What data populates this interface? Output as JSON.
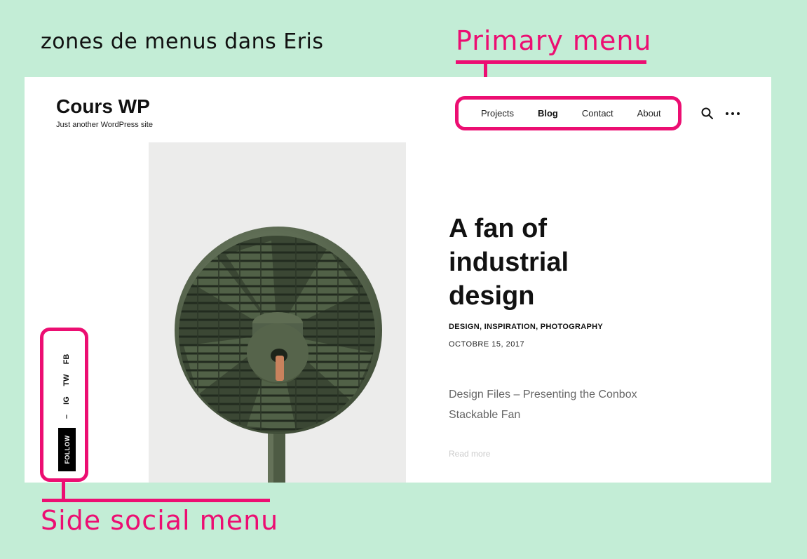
{
  "annotation": {
    "title": "zones de menus dans Eris",
    "primary_menu_label": "Primary menu",
    "side_menu_label": "Side social menu",
    "accent_color": "#ec0e72",
    "background_color": "#c3edd6"
  },
  "site": {
    "title": "Cours WP",
    "tagline": "Just another WordPress site"
  },
  "nav": {
    "items": [
      {
        "label": "Projects",
        "active": false
      },
      {
        "label": "Blog",
        "active": true
      },
      {
        "label": "Contact",
        "active": false
      },
      {
        "label": "About",
        "active": false
      }
    ],
    "search_icon": "search-icon",
    "more_icon": "more-dots-icon"
  },
  "post": {
    "title": "A fan of industrial design",
    "categories": "DESIGN, INSPIRATION, PHOTOGRAPHY",
    "date": "OCTOBRE 15, 2017",
    "excerpt": "Design Files – Presenting the Conbox Stackable Fan",
    "read_more": "Read more"
  },
  "social": {
    "items": [
      "FB",
      "TW",
      "IG"
    ],
    "separator": "–",
    "follow_label": "FOLLOW"
  }
}
